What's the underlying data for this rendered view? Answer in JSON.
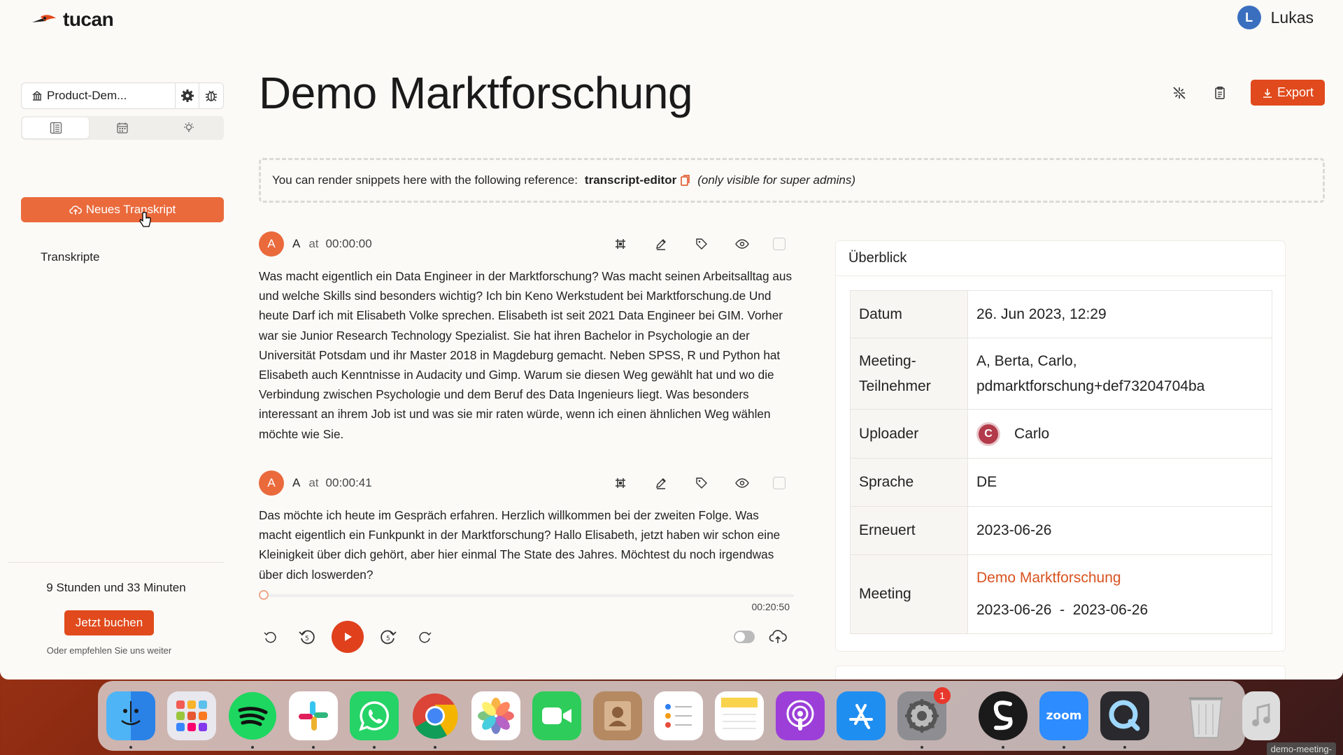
{
  "app": {
    "brand": "tucan",
    "user_initial": "L",
    "user_name": "Lukas"
  },
  "sidebar": {
    "workspace_name": "Product-Dem...",
    "new_transcript_label": "Neues Transkript",
    "link_transcripts": "Transkripte",
    "hours_remaining": "9 Stunden und 33 Minuten",
    "buy_label": "Jetzt buchen",
    "recommend_text": "Oder empfehlen Sie uns weiter"
  },
  "main": {
    "title": "Demo Marktforschung",
    "export_label": "Export",
    "snippet": {
      "prefix": "You can render snippets here with the following reference:",
      "reference": "transcript-editor",
      "suffix": "(only visible for super admins)"
    },
    "segments": [
      {
        "speaker_initial": "A",
        "speaker": "A",
        "at": "at",
        "time": "00:00:00",
        "text": "Was macht eigentlich ein Data Engineer in der Marktforschung? Was macht seinen Arbeitsalltag aus und welche Skills sind besonders wichtig? Ich bin Keno Werkstudent bei Marktforschung.de Und heute Darf ich mit Elisabeth Volke sprechen. Elisabeth ist seit 2021 Data Engineer bei GIM. Vorher war sie Junior Research Technology Spezialist. Sie hat ihren Bachelor in Psychologie an der Universität Potsdam und ihr Master 2018 in Magdeburg gemacht. Neben SPSS, R und Python hat Elisabeth auch Kenntnisse in Audacity und Gimp. Warum sie diesen Weg gewählt hat und wo die Verbindung zwischen Psychologie und dem Beruf des Data Ingenieurs liegt. Was besonders interessant an ihrem Job ist und was sie mir raten würde, wenn ich einen ähnlichen Weg wählen möchte wie Sie."
      },
      {
        "speaker_initial": "A",
        "speaker": "A",
        "at": "at",
        "time": "00:00:41",
        "text": "Das möchte ich heute im Gespräch erfahren. Herzlich willkommen bei der zweiten Folge. Was macht eigentlich ein Funkpunkt in der Marktforschung? Hallo Elisabeth, jetzt haben wir schon eine Kleinigkeit über dich gehört, aber hier einmal The State des Jahres. Möchtest du noch irgendwas über dich loswerden?"
      }
    ],
    "player": {
      "duration": "00:20:50",
      "progress": 0
    }
  },
  "overview": {
    "title": "Überblick",
    "rows": {
      "datum_label": "Datum",
      "datum_value": "26. Jun 2023, 12:29",
      "participants_label_1": "Meeting-",
      "participants_label_2": "Teilnehmer",
      "participants_value_1": "A, Berta, Carlo,",
      "participants_value_2": "pdmarktforschung+def73204704ba",
      "uploader_label": "Uploader",
      "uploader_initial": "C",
      "uploader_name": "Carlo",
      "sprache_label": "Sprache",
      "sprache_value": "DE",
      "erneuert_label": "Erneuert",
      "erneuert_value": "2023-06-26",
      "meeting_label": "Meeting",
      "meeting_link": "Demo Marktforschung",
      "meeting_range": "2023-06-26  -  2023-06-26"
    }
  },
  "dock": {
    "apps": [
      "Finder",
      "Launchpad",
      "Spotify",
      "Slack",
      "WhatsApp",
      "Chrome",
      "Photos",
      "FaceTime",
      "Contacts",
      "Reminders",
      "Notes",
      "Podcasts",
      "App Store",
      "System Settings",
      "Scribe",
      "Zoom",
      "QuickTime",
      "Trash"
    ],
    "settings_badge": "1",
    "window_label": "demo-meeting-"
  },
  "colors": {
    "accent": "#e04a1c",
    "accent_light": "#ea6a3c",
    "link": "#d9521f"
  }
}
